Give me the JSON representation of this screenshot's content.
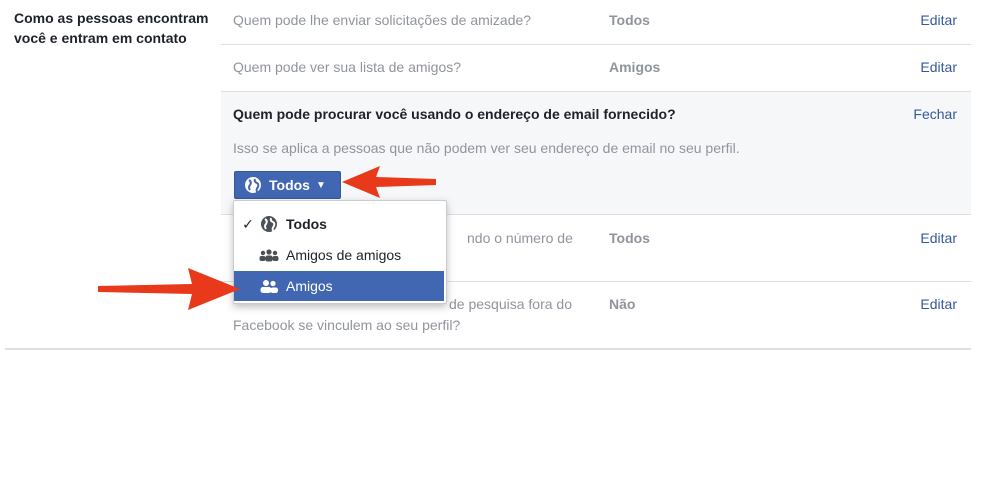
{
  "section": {
    "label": "Como as pessoas encontram você e entram em contato"
  },
  "rows": [
    {
      "question": "Quem pode lhe enviar solicitações de amizade?",
      "value": "Todos",
      "action": "Editar"
    },
    {
      "question": "Quem pode ver sua lista de amigos?",
      "value": "Amigos",
      "action": "Editar"
    }
  ],
  "expanded": {
    "title": "Quem pode procurar você usando o endereço de email fornecido?",
    "close": "Fechar",
    "description": "Isso se aplica a pessoas que não podem ver seu endereço de email no seu perfil.",
    "button_label": "Todos"
  },
  "row_phone": {
    "question_visible": "ndo o número de",
    "value": "Todos",
    "action": "Editar"
  },
  "row_search": {
    "question_line1": "de pesquisa fora do",
    "question_line2": "Facebook se vinculem ao seu perfil?",
    "value": "Não",
    "action": "Editar"
  },
  "menu": {
    "items": [
      {
        "label": "Todos",
        "checked": true,
        "icon": "globe-icon"
      },
      {
        "label": "Amigos de amigos",
        "checked": false,
        "icon": "friends-of-friends-icon"
      },
      {
        "label": "Amigos",
        "checked": false,
        "icon": "friends-icon",
        "highlighted": true
      }
    ]
  },
  "colors": {
    "accent": "#4267b2",
    "link": "#365899",
    "arrow": "#e8391a",
    "muted": "#90949c"
  }
}
